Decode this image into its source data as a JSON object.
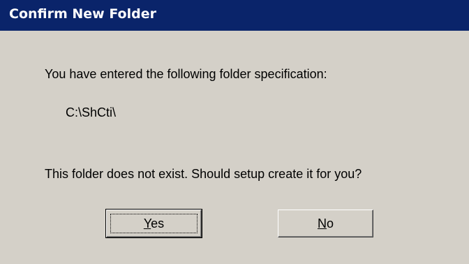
{
  "window": {
    "title": "Confirm New Folder"
  },
  "message": {
    "spec_line": "You have entered the following folder specification:",
    "folder_path": "C:\\ShCti\\",
    "prompt_line": "This folder does not exist.  Should setup create it for you?"
  },
  "buttons": {
    "yes": {
      "mnemonic": "Y",
      "rest": "es"
    },
    "no": {
      "mnemonic": "N",
      "rest": "o"
    }
  },
  "colors": {
    "titlebar": "#0a246a",
    "dialog_bg": "#d4d0c8"
  }
}
